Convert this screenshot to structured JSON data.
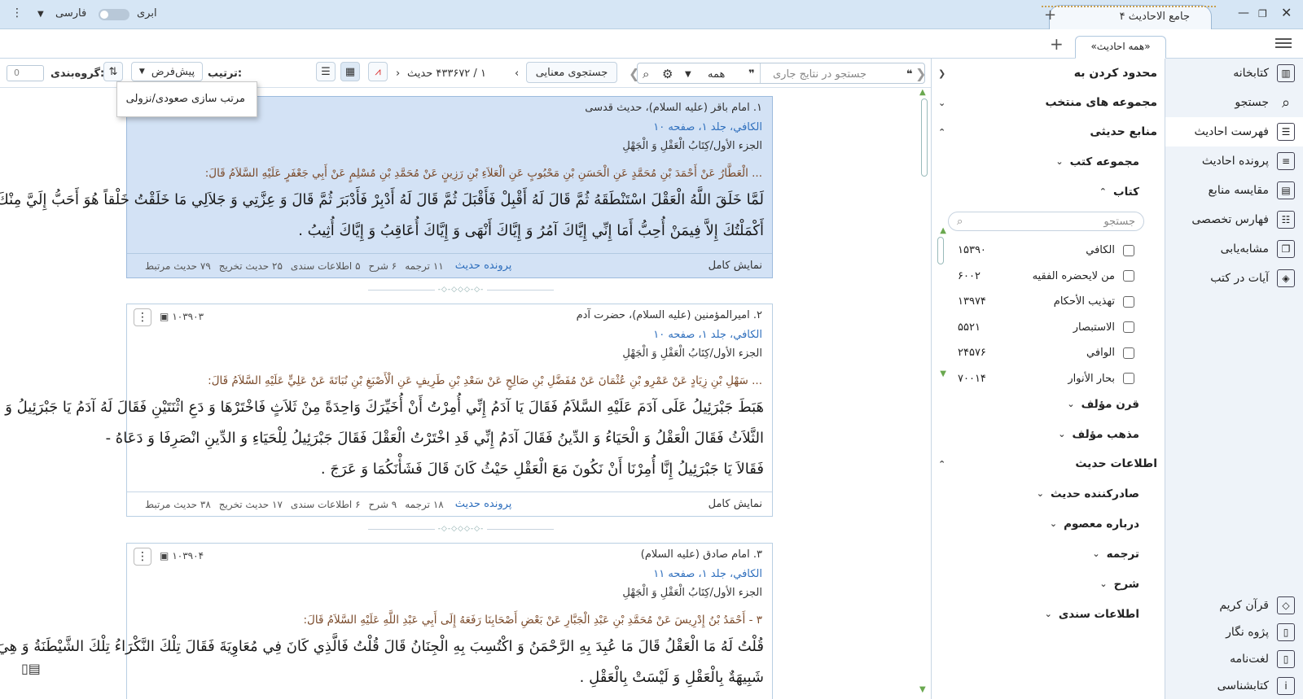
{
  "window": {
    "title": "جامع الاحادیث ۴",
    "lang_label": "فارسی",
    "theme_label": "ابری",
    "doc_tab": "«همه احادیث»"
  },
  "right_nav": {
    "items": [
      {
        "label": "کتابخانه",
        "icon": "library-icon"
      },
      {
        "label": "جستجو",
        "icon": "search-icon"
      },
      {
        "label": "فهرست احادیث",
        "icon": "index-icon"
      },
      {
        "label": "پرونده احادیث",
        "icon": "file-icon"
      },
      {
        "label": "مقایسه منابع",
        "icon": "compare-icon"
      },
      {
        "label": "فهارس تخصصی",
        "icon": "list-icon"
      },
      {
        "label": "مشابه‌یابی",
        "icon": "similar-icon"
      },
      {
        "label": "آیات در کتب",
        "icon": "verses-icon"
      }
    ],
    "bottom": [
      {
        "label": "قرآن کریم",
        "icon": "quran-icon"
      },
      {
        "label": "پژوه نگار",
        "icon": "note-icon"
      },
      {
        "label": "لغت‌نامه",
        "icon": "dictionary-icon"
      },
      {
        "label": "کتابشناسی",
        "icon": "info-icon"
      }
    ]
  },
  "filter": {
    "header": "محدود کردن به",
    "selected": "مجموعه های منتخب",
    "sources": "منابع حدیثی",
    "book_collections": "مجموعه کتب",
    "books": "کتاب",
    "search_placeholder": "جستجو",
    "book_list": [
      {
        "name": "الکافي",
        "count": "۱۵۳۹۰"
      },
      {
        "name": "من لایحضره الفقیه",
        "count": "۶۰۰۲"
      },
      {
        "name": "تهذیب الأحكام",
        "count": "۱۳۹۷۴"
      },
      {
        "name": "الاستبصار",
        "count": "۵۵۲۱"
      },
      {
        "name": "الوافي",
        "count": "۲۴۵۷۶"
      },
      {
        "name": "بحار الأنوار",
        "count": "۷۰۰۱۴"
      }
    ],
    "author_century": "قرن مؤلف",
    "author_sect": "مذهب مؤلف",
    "hadith_info": "اطلاعات حدیث",
    "issuer": "صادرکننده حدیث",
    "about_masoom": "درباره معصوم",
    "translation": "ترجمه",
    "commentary": "شرح",
    "isnad": "اطلاعات سندی"
  },
  "toolbar": {
    "search_placeholder": "جستجو در نتایج جاری",
    "scope": "همه",
    "semantic": "جستجوی معنایی",
    "pager": "۱ / ۴۳۳۶۷۲ حدیث",
    "sort_label": "ترتیب:",
    "sort_value": "پیش‌فرض",
    "group_label": "گروه‌بندی:",
    "group_value": "0",
    "tooltip": "مرتب سازی صعودی/نزولی"
  },
  "hadiths": [
    {
      "num": "۱.",
      "speaker": "امام باقر (علیه السلام)، حدیث قدسی",
      "source": "الكافي، جلد ۱، صفحه ۱۰",
      "chapter": "الجزء الأول/كِتَابُ الْعَقْلِ وَ الْجَهْلِ",
      "chain": "... الْعَطَّارُ عَنْ أَحْمَدَ بْنِ مُحَمَّدٍ عَنِ الْحَسَنِ بْنِ مَحْبُوبٍ عَنِ الْعَلاَءِ بْنِ رَزِينٍ عَنْ مُحَمَّدِ بْنِ مُسْلِمٍ عَنْ أَبِي جَعْفَرٍ عَلَيْهِ السَّلاَمُ قَالَ:",
      "text": [
        "لَمَّا خَلَقَ اللَّهُ الْعَقْلَ اسْتَنْطَقَهُ ثُمَّ قَالَ لَهُ أَقْبِلْ فَأَقْبَلَ ثُمَّ قَالَ لَهُ أَدْبِرْ فَأَدْبَرَ ثُمَّ قَالَ وَ عِزَّتِي وَ جَلاَلِي مَا خَلَقْتُ خَلْقاً هُوَ أَحَبُّ إِلَيَّ مِنْكَ وَ لاَ",
        "أَكْمَلْتُكَ إِلاَّ فِيمَنْ أُحِبُّ أَمَا إِنِّي إِيَّاكَ آمُرُ وَ إِيَّاكَ أَنْهَى وَ إِيَّاكَ أُعَاقِبُ وَ إِيَّاكَ أُثِيبُ ."
      ],
      "full": "نمایش کامل",
      "file": "پرونده حدیث",
      "stats": [
        "۱۱ ترجمه",
        "۶ شرح",
        "۵ اطلاعات سندی",
        "۲۵ حدیث تخریج",
        "۷۹ حدیث مرتبط"
      ]
    },
    {
      "num": "۲.",
      "speaker": "امیرالمؤمنین (علیه السلام)، حضرت آدم",
      "id": "۱۰۳۹۰۳",
      "source": "الكافي، جلد ۱، صفحه ۱۰",
      "chapter": "الجزء الأول/كِتَابُ الْعَقْلِ وَ الْجَهْلِ",
      "chain": "... سَهْلِ بْنِ زِيَادٍ عَنْ عَمْرِو بْنِ عُثْمَانَ عَنْ مُفَضَّلِ بْنِ صَالِحٍ عَنْ سَعْدِ بْنِ طَرِيفٍ عَنِ الْأَصْبَغِ بْنِ نُبَاتَةَ عَنْ عَلِيٍّ عَلَيْهِ السَّلاَمُ قَالَ:",
      "text": [
        "هَبَطَ جَبْرَئِيلُ عَلَى آدَمَ عَلَيْهِ السَّلاَمُ فَقَالَ يَا آدَمُ إِنِّي أُمِرْتُ أَنْ أُخَيِّرَكَ وَاحِدَةً مِنْ ثَلاَثٍ فَاخْتَرْهَا وَ دَعِ اثْنَتَيْنِ فَقَالَ لَهُ آدَمُ يَا جَبْرَئِيلُ وَ مَا",
        "الثَّلاَثُ فَقَالَ الْعَقْلُ وَ الْحَيَاءُ وَ الدِّينُ فَقَالَ آدَمُ إِنِّي قَدِ اخْتَرْتُ الْعَقْلَ فَقَالَ جَبْرَئِيلُ لِلْحَيَاءِ وَ الدِّينِ انْصَرِفَا وَ دَعَاهُ -",
        "فَقَالاَ يَا جَبْرَئِيلُ إِنَّا أُمِرْنَا أَنْ نَكُونَ مَعَ الْعَقْلِ حَيْثُ كَانَ قَالَ فَشَأْنَكُمَا وَ عَرَجَ ."
      ],
      "full": "نمایش کامل",
      "file": "پرونده حدیث",
      "stats": [
        "۱۸ ترجمه",
        "۹ شرح",
        "۶ اطلاعات سندی",
        "۱۷ حدیث تخریج",
        "۳۸ حدیث مرتبط"
      ]
    },
    {
      "num": "۳.",
      "speaker": "امام صادق (علیه السلام)",
      "id": "۱۰۳۹۰۴",
      "source": "الكافي، جلد ۱، صفحه ۱۱",
      "chapter": "الجزء الأول/كِتَابُ الْعَقْلِ وَ الْجَهْلِ",
      "chain": "۳ - أَحْمَدُ بْنُ إِدْرِيسَ عَنْ مُحَمَّدِ بْنِ عَبْدِ الْجَبَّارِ عَنْ بَعْضِ أَصْحَابِنَا رَفَعَهُ إِلَى أَبِي عَبْدِ اللَّهِ عَلَيْهِ السَّلاَمُ قَالَ:",
      "text": [
        "قُلْتُ لَهُ مَا الْعَقْلُ قَالَ مَا عُبِدَ بِهِ الرَّحْمَنُ وَ اكْتُسِبَ بِهِ الْجِنَانُ قَالَ قُلْتُ فَالَّذِي كَانَ فِي مُعَاوِيَةَ فَقَالَ تِلْكَ النَّكْرَاءُ تِلْكَ الشَّيْطَنَةُ وَ هِيَ",
        "شَبِيهَةٌ بِالْعَقْلِ وَ لَيْسَتْ بِالْعَقْلِ ."
      ]
    }
  ]
}
